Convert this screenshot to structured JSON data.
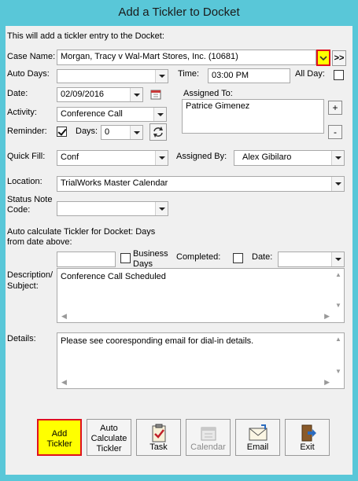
{
  "window": {
    "title": "Add a Tickler to Docket"
  },
  "intro": "This will add a tickler entry to the Docket:",
  "case_name": {
    "label": "Case Name:",
    "value": "Morgan, Tracy v Wal-Mart Stores, Inc.  (10681)",
    "more_label": ">>"
  },
  "auto_days": {
    "label": "Auto Days:",
    "value": ""
  },
  "time": {
    "label": "Time:",
    "value": "03:00 PM"
  },
  "all_day": {
    "label": "All Day:",
    "checked": false
  },
  "date": {
    "label": "Date:",
    "value": "02/09/2016"
  },
  "assigned_to": {
    "label": "Assigned To:",
    "names": [
      "Patrice Gimenez"
    ],
    "add_label": "+",
    "remove_label": "-"
  },
  "activity": {
    "label": "Activity:",
    "value": "Conference Call"
  },
  "reminder": {
    "label": "Reminder:",
    "checked": true,
    "days_label": "Days:",
    "days_value": "0"
  },
  "quick_fill": {
    "label": "Quick Fill:",
    "value": "Conf"
  },
  "assigned_by": {
    "label": "Assigned By:",
    "value": "Alex Gibilaro"
  },
  "location": {
    "label": "Location:",
    "value": "TrialWorks Master Calendar"
  },
  "status_note": {
    "label_line1": "Status Note",
    "label_line2": "Code:",
    "value": ""
  },
  "auto_calc": {
    "text_line1": "Auto calculate Tickler for Docket: Days",
    "text_line2": "from date above:",
    "value": ""
  },
  "business_days": {
    "label_line1": "Business",
    "label_line2": "Days",
    "checked": false
  },
  "completed": {
    "label": "Completed:",
    "checked": false
  },
  "completed_date": {
    "label": "Date:",
    "value": ""
  },
  "description": {
    "label_line1": "Description/",
    "label_line2": "Subject:",
    "value": "Conference Call Scheduled"
  },
  "details": {
    "label": "Details:",
    "value": "Please see cooresponding email for dial-in details."
  },
  "buttons": {
    "add_tickler": {
      "line1": "Add",
      "line2": "Tickler"
    },
    "auto_calc": {
      "line1": "Auto",
      "line2": "Calculate",
      "line3": "Tickler"
    },
    "task": "Task",
    "calendar": "Calendar",
    "email": "Email",
    "exit": "Exit"
  },
  "colors": {
    "highlight": "#ffff00",
    "highlight_border": "#e0101e",
    "disabled_text": "#8a8a8a"
  }
}
